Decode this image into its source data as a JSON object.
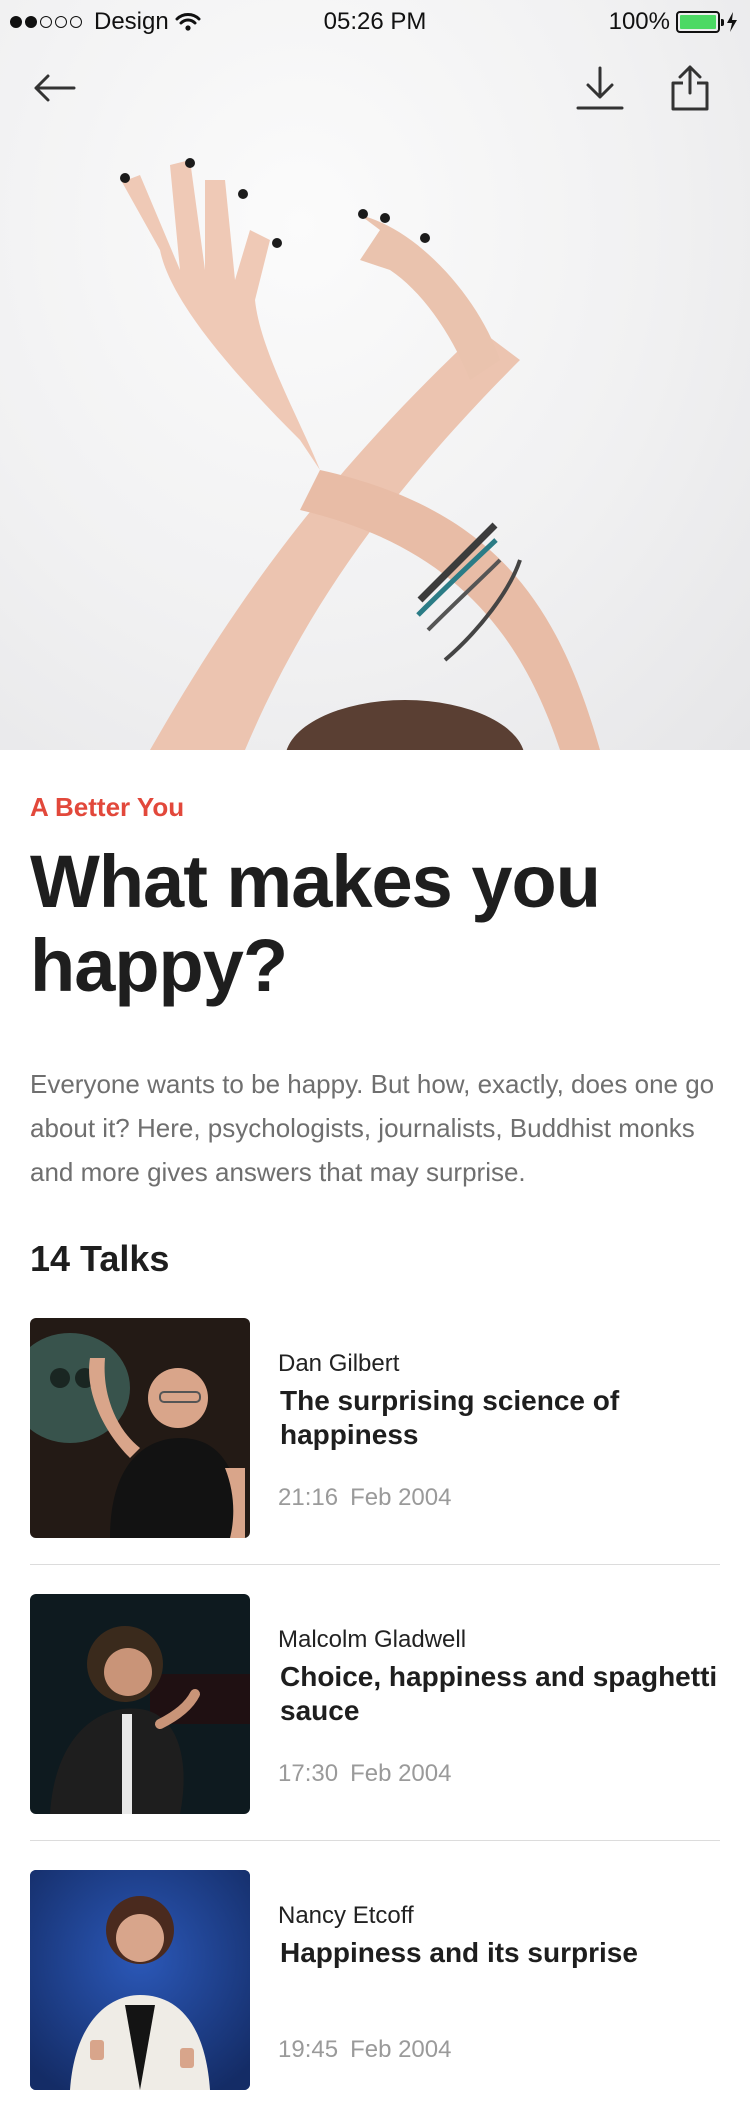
{
  "status_bar": {
    "carrier": "Design",
    "time": "05:26 PM",
    "battery": "100%",
    "battery_level": 1.0
  },
  "nav": {
    "back_icon": "arrow-left-icon",
    "download_icon": "download-icon",
    "share_icon": "share-icon"
  },
  "article": {
    "category": "A Better You",
    "title": "What makes you happy?",
    "description": "Everyone wants to be happy. But how, exactly, does one go about it? Here, psychologists, journalists, Buddhist monks and more gives answers that may surprise.",
    "talk_count": "14 Talks"
  },
  "talks": [
    {
      "speaker": "Dan Gilbert",
      "title": "The surprising science of happiness",
      "duration": "21:16",
      "date": "Feb 2004"
    },
    {
      "speaker": "Malcolm Gladwell",
      "title": "Choice, happiness and spaghetti sauce",
      "duration": "17:30",
      "date": "Feb 2004"
    },
    {
      "speaker": "Nancy Etcoff",
      "title": "Happiness and its surprise",
      "duration": "19:45",
      "date": "Feb 2004"
    }
  ],
  "colors": {
    "accent": "#e2483b",
    "battery": "#4cd964"
  }
}
